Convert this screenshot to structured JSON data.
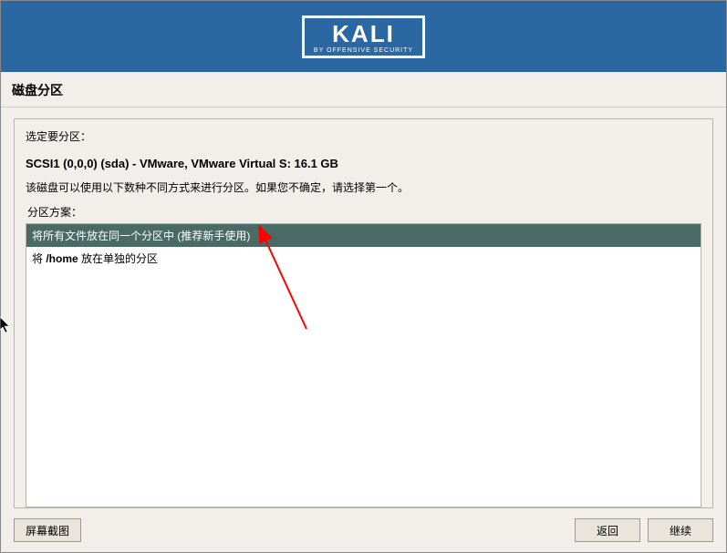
{
  "header": {
    "logo_main": "KALI",
    "logo_sub": "BY OFFENSIVE SECURITY"
  },
  "page": {
    "title": "磁盘分区"
  },
  "panel": {
    "prompt": "选定要分区：",
    "disk": "SCSI1 (0,0,0) (sda) - VMware, VMware Virtual S: 16.1 GB",
    "instruction": "该磁盘可以使用以下数种不同方式来进行分区。如果您不确定，请选择第一个。",
    "group_label": "分区方案：",
    "options": [
      {
        "label": "将所有文件放在同一个分区中 (推荐新手使用)",
        "selected": true
      },
      {
        "label_prefix": "将 ",
        "label_strong": "/home",
        "label_suffix": " 放在单独的分区",
        "selected": false
      }
    ]
  },
  "buttons": {
    "screenshot": "屏幕截图",
    "back": "返回",
    "continue": "继续"
  }
}
